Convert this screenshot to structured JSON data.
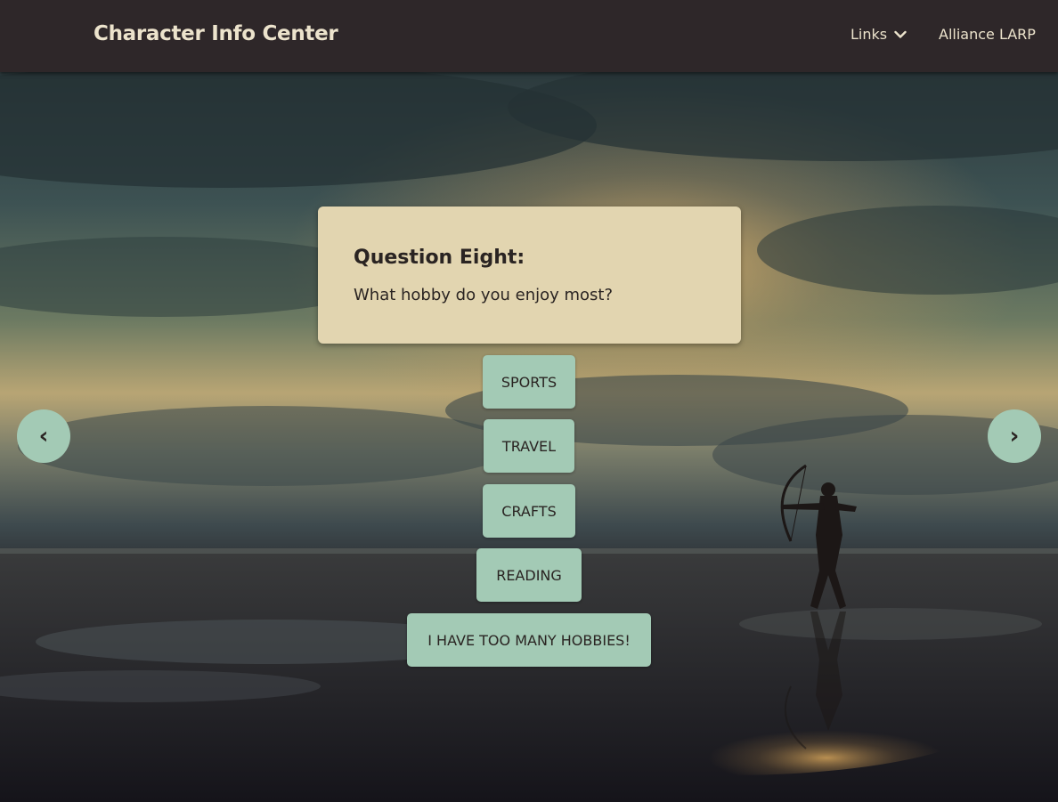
{
  "navbar": {
    "brand": "Character Info Center",
    "links_label": "Links",
    "alliance_label": "Alliance LARP"
  },
  "question": {
    "title": "Question Eight:",
    "text": "What hobby do you enjoy most?"
  },
  "answers": [
    {
      "label": "SPORTS"
    },
    {
      "label": "TRAVEL"
    },
    {
      "label": "CRAFTS"
    },
    {
      "label": "READING"
    },
    {
      "label": "I HAVE TOO MANY HOBBIES!"
    }
  ],
  "carousel": {
    "prev_label": "‹",
    "next_label": "›"
  },
  "colors": {
    "navbar": "#2e2729",
    "card": "#e2d5b0",
    "button": "#a3cab5",
    "text": "#2a2422",
    "nav_text": "#ece3cc"
  },
  "icons": {
    "links_dropdown": "chevron-down-icon",
    "background": "archer-at-sunset-image"
  }
}
